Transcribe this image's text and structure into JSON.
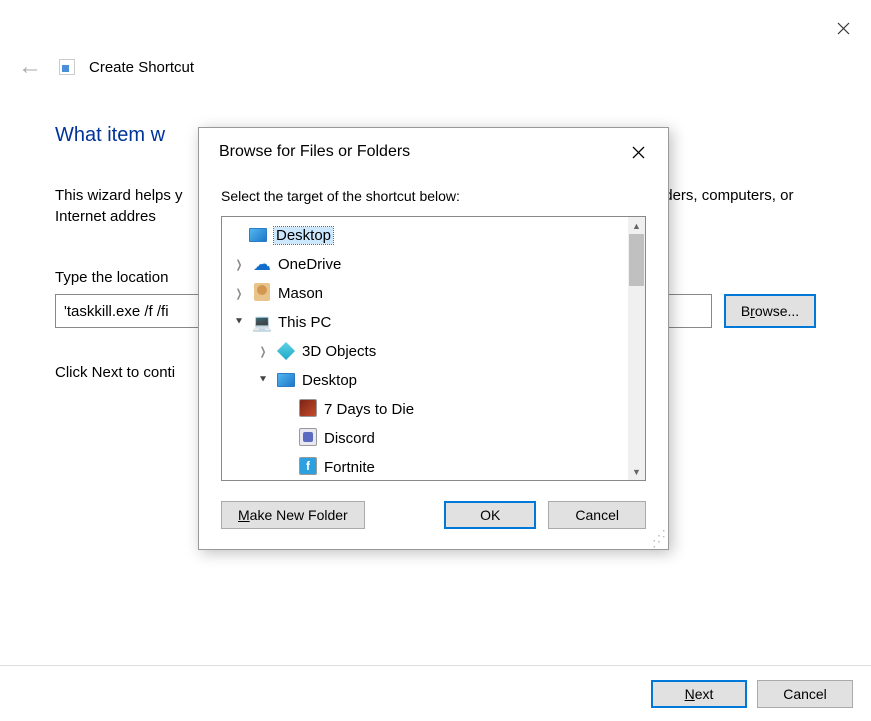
{
  "wizard": {
    "title": "Create Shortcut",
    "heading_visible": "What item w",
    "desc_prefix": "This wizard helps y",
    "desc_suffix": "lders, computers, or Internet addres",
    "location_label_visible": "Type the location",
    "path_value": "'taskkill.exe /f /fi",
    "browse_label": "Browse...",
    "hint_visible": "Click Next to conti",
    "next_label": "Next",
    "cancel_label": "Cancel"
  },
  "dialog": {
    "title": "Browse for Files or Folders",
    "subtitle": "Select the target of the shortcut below:",
    "make_folder_label": "Make New Folder",
    "ok_label": "OK",
    "cancel_label": "Cancel",
    "tree": [
      {
        "label": "Desktop",
        "indent": 0,
        "expand": "",
        "icon": "desktop",
        "selected": true
      },
      {
        "label": "OneDrive",
        "indent": 1,
        "expand": "right",
        "icon": "onedrive",
        "selected": false
      },
      {
        "label": "Mason",
        "indent": 1,
        "expand": "right",
        "icon": "user",
        "selected": false
      },
      {
        "label": "This PC",
        "indent": 1,
        "expand": "down",
        "icon": "pc",
        "selected": false
      },
      {
        "label": "3D Objects",
        "indent": 2,
        "expand": "right",
        "icon": "3d",
        "selected": false
      },
      {
        "label": "Desktop",
        "indent": 2,
        "expand": "down",
        "icon": "desktop",
        "selected": false
      },
      {
        "label": "7 Days to Die",
        "indent": 3,
        "expand": "",
        "icon": "7days",
        "selected": false
      },
      {
        "label": "Discord",
        "indent": 3,
        "expand": "",
        "icon": "discord",
        "selected": false
      },
      {
        "label": "Fortnite",
        "indent": 3,
        "expand": "",
        "icon": "fortnite",
        "selected": false
      }
    ]
  }
}
